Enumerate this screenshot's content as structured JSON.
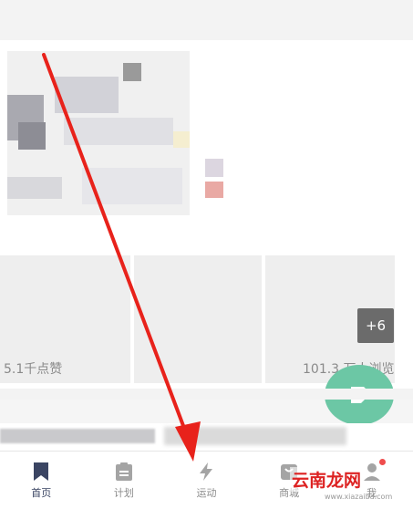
{
  "post": {
    "likes": "5.1千点赞",
    "views": "101.3 万人浏览",
    "more_images": "+6"
  },
  "tabbar": {
    "items": [
      {
        "label": "首页",
        "icon": "bookmark-icon",
        "active": true
      },
      {
        "label": "计划",
        "icon": "clipboard-icon",
        "active": false
      },
      {
        "label": "运动",
        "icon": "lightning-icon",
        "active": false
      },
      {
        "label": "商城",
        "icon": "shop-bag-icon",
        "active": false
      },
      {
        "label": "我",
        "icon": "profile-icon",
        "active": false
      }
    ]
  },
  "watermark": {
    "text": "云南龙网",
    "sub": "www.xiazaiba.com"
  },
  "colors": {
    "accent_dark": "#3b4563",
    "fab_green": "#6cc7a5",
    "badge_red": "#ef4d4d",
    "arrow_red": "#e8221b"
  }
}
